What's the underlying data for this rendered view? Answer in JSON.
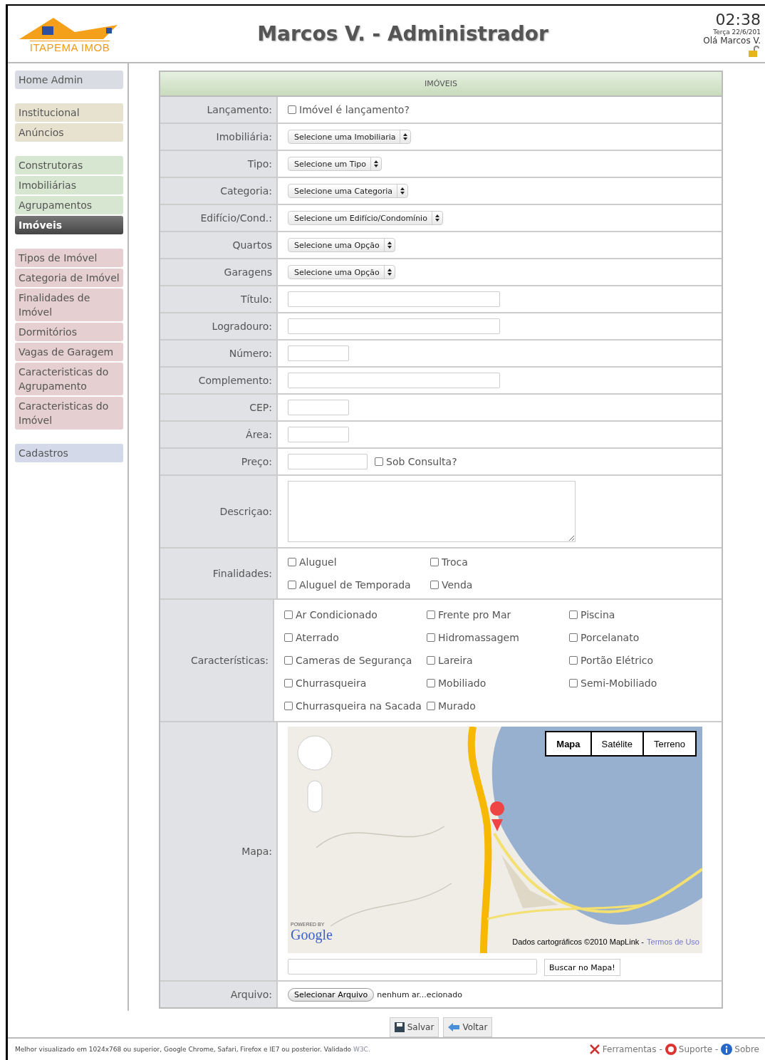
{
  "header": {
    "logo_text": "ITAPEMA IMOB",
    "title": "Marcos V. - Administrador",
    "time": "02:38",
    "date": "Terça 22/6/201",
    "greeting": "Olá Marcos V."
  },
  "sidebar": {
    "groups": [
      {
        "color": "#d9dce2",
        "items": [
          {
            "label": "Home Admin",
            "selected": false
          }
        ]
      },
      {
        "color": "#e6e2cf",
        "items": [
          {
            "label": "Institucional",
            "selected": false
          },
          {
            "label": "Anúncios",
            "selected": false
          }
        ]
      },
      {
        "color": "#d6e6d0",
        "items": [
          {
            "label": "Construtoras",
            "selected": false
          },
          {
            "label": "Imobiliárias",
            "selected": false
          },
          {
            "label": "Agrupamentos",
            "selected": false
          },
          {
            "label": "Imóveis",
            "selected": true
          }
        ]
      },
      {
        "color": "#e6cfd0",
        "items": [
          {
            "label": "Tipos de Imóvel",
            "selected": false
          },
          {
            "label": "Categoria de Imóvel",
            "selected": false
          },
          {
            "label": "Finalidades de Imóvel",
            "selected": false
          },
          {
            "label": "Dormitórios",
            "selected": false
          },
          {
            "label": "Vagas de Garagem",
            "selected": false
          },
          {
            "label": "Caracteristicas do Agrupamento",
            "selected": false
          },
          {
            "label": "Caracteristicas do Imóvel",
            "selected": false
          }
        ]
      },
      {
        "color": "#d3d9e8",
        "items": [
          {
            "label": "Cadastros",
            "selected": false
          }
        ]
      }
    ]
  },
  "form": {
    "title": "IMÓVEIS",
    "rows": [
      {
        "kind": "checkbox",
        "label": "Lançamento:",
        "option": "Imóvel é lançamento?",
        "checked": false
      },
      {
        "kind": "select",
        "label": "Imobiliária:",
        "value": "Selecione uma Imobiliaria"
      },
      {
        "kind": "select",
        "label": "Tipo:",
        "value": "Selecione um Tipo"
      },
      {
        "kind": "select",
        "label": "Categoria:",
        "value": "Selecione uma Categoria"
      },
      {
        "kind": "select",
        "label": "Edifício/Cond.:",
        "value": "Selecione um Edifício/Condomínio"
      },
      {
        "kind": "select",
        "label": "Quartos",
        "value": "Selecione uma Opção"
      },
      {
        "kind": "select",
        "label": "Garagens",
        "value": "Selecione uma Opção"
      },
      {
        "kind": "longtext",
        "label": "Título:"
      },
      {
        "kind": "longtext",
        "label": "Logradouro:"
      },
      {
        "kind": "shorttext",
        "label": "Número:"
      },
      {
        "kind": "longtext",
        "label": "Complemento:"
      },
      {
        "kind": "shorttext",
        "label": "CEP:"
      },
      {
        "kind": "shorttext",
        "label": "Área:"
      },
      {
        "kind": "price",
        "label": "Preço:",
        "option": "Sob Consulta?",
        "checked": false
      },
      {
        "kind": "textarea",
        "label": "Descriçao:"
      },
      {
        "kind": "checkgrid",
        "label": "Finalidades:",
        "options": [
          {
            "label": "Aluguel",
            "checked": false
          },
          {
            "label": "Troca",
            "checked": false
          },
          {
            "label": "Aluguel de Temporada",
            "checked": false
          },
          {
            "label": "Venda",
            "checked": false
          }
        ]
      },
      {
        "kind": "checkgrid",
        "label": "Características:",
        "options": [
          {
            "label": "Ar Condicionado",
            "checked": false
          },
          {
            "label": "Frente pro Mar",
            "checked": false
          },
          {
            "label": "Piscina",
            "checked": false
          },
          {
            "label": "Aterrado",
            "checked": false
          },
          {
            "label": "Hidromassagem",
            "checked": false
          },
          {
            "label": "Porcelanato",
            "checked": false
          },
          {
            "label": "Cameras de Segurança",
            "checked": false
          },
          {
            "label": "Lareira",
            "checked": false
          },
          {
            "label": "Portão Elétrico",
            "checked": false
          },
          {
            "label": "Churrasqueira",
            "checked": false
          },
          {
            "label": "Mobiliado",
            "checked": false
          },
          {
            "label": "Semi-Mobiliado",
            "checked": false
          },
          {
            "label": "Churrasqueira na Sacada",
            "checked": false
          },
          {
            "label": "Murado",
            "checked": false
          }
        ]
      },
      {
        "kind": "map",
        "label": "Mapa:",
        "map_types": [
          {
            "label": "Mapa",
            "selected": true
          },
          {
            "label": "Satélite",
            "selected": false
          },
          {
            "label": "Terreno",
            "selected": false
          }
        ],
        "powered_by": "POWERED BY",
        "brand": "Google",
        "attribution": "Dados cartográficos ©2010 MapLink -",
        "terms": "Termos de Uso",
        "search_button": "Buscar no Mapa!"
      },
      {
        "kind": "file",
        "label": "Arquivo:",
        "button": "Selecionar Arquivo",
        "status": "nenhum ar...ecionado"
      }
    ]
  },
  "actions": [
    "Salvar",
    "Voltar"
  ],
  "footer": {
    "note": "Melhor visualizado em 1024x768 ou superior, Google Chrome, Safari, Firefox e IE7 ou posterior. Validado",
    "link": "W3C.",
    "links": [
      "Ferramentas",
      "Suporte",
      "Sobre"
    ],
    "separator": "-"
  }
}
